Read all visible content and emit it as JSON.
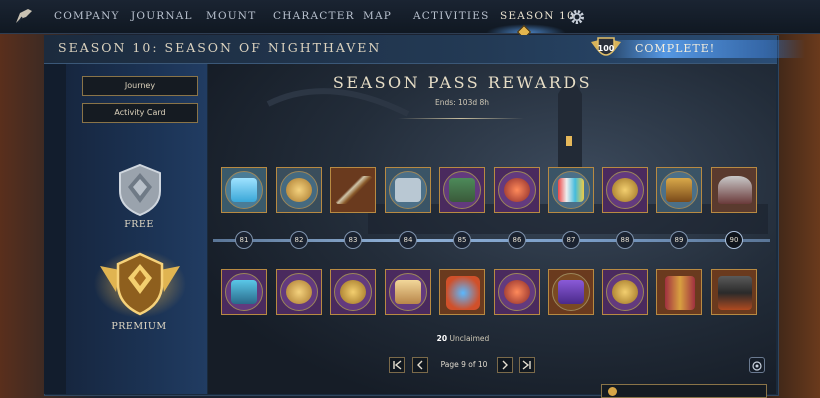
{
  "nav": {
    "items": [
      "COMPANY",
      "JOURNAL",
      "MOUNT",
      "CHARACTER",
      "MAP",
      "ACTIVITIES",
      "SEASON 10"
    ],
    "active": "SEASON 10"
  },
  "season": {
    "title": "SEASON 10: SEASON OF NIGHTHAVEN",
    "level_badge": "100",
    "status": "COMPLETE!"
  },
  "sidebar": {
    "buttons": [
      "Journey",
      "Activity Card"
    ],
    "free_label": "FREE",
    "premium_label": "PREMIUM"
  },
  "rewards": {
    "title": "SEASON PASS REWARDS",
    "ends": "Ends: 103d 8h",
    "levels": [
      "81",
      "82",
      "83",
      "84",
      "85",
      "86",
      "87",
      "88",
      "89",
      "90"
    ],
    "free_items": [
      "crystals-icon",
      "coin-stack-icon",
      "bow-icon",
      "supply-crate-icon",
      "chest-icon",
      "emblem-icon",
      "paint-pots-icon",
      "token-icon",
      "treasure-chest-icon",
      "helmet-icon"
    ],
    "premium_items": [
      "crystal-box-icon",
      "coin-stack-icon",
      "token-icon",
      "ornate-box-icon",
      "gem-emblem-icon",
      "emblem-icon",
      "pouch-icon",
      "token-icon",
      "armor-pants-icon",
      "armor-chest-icon"
    ],
    "unclaimed_count": "20",
    "unclaimed_label": "Unclaimed",
    "page_text": "Page 9 of 10"
  },
  "colors": {
    "gold": "#b88a42",
    "track_blue": "#8fb0d6",
    "premium_purple": "#4a2a5e"
  }
}
